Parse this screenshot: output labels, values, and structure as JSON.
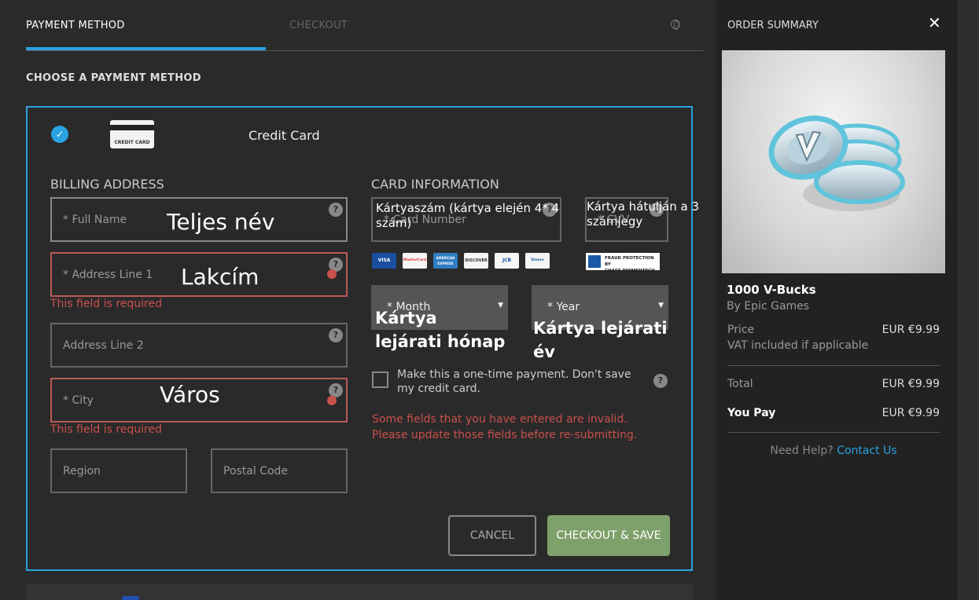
{
  "tabs": {
    "payment_method": "PAYMENT METHOD",
    "checkout": "CHECKOUT"
  },
  "section_heading": "CHOOSE A PAYMENT METHOD",
  "payment_option": {
    "icon_label": "CREDIT CARD",
    "title": "Credit Card"
  },
  "billing": {
    "heading": "BILLING ADDRESS",
    "full_name": {
      "placeholder": "* Full Name",
      "overlay": "Teljes név"
    },
    "address1": {
      "placeholder": "* Address Line 1",
      "overlay": "Lakcím",
      "error": "This field is required"
    },
    "address2": {
      "placeholder": "Address Line 2"
    },
    "city": {
      "placeholder": "* City",
      "overlay": "Város",
      "error": "This field is required"
    },
    "region": {
      "placeholder": "Region"
    },
    "postal": {
      "placeholder": "Postal Code"
    }
  },
  "card": {
    "heading": "CARD INFORMATION",
    "number": {
      "placeholder": "* Card Number",
      "overlay": "Kártyaszám (kártya elején 4* 4 szám)"
    },
    "cvv": {
      "placeholder": "* CVV",
      "overlay": "Kártya hátulján a 3 számjegy"
    },
    "logos": [
      "VISA",
      "MasterCard",
      "AMERICAN EXPRESS",
      "DISCOVER",
      "JCB",
      "Diners"
    ],
    "chase_text": [
      "FRAUD PROTECTION BY",
      "CHASE PAYMENTECH"
    ],
    "month": {
      "placeholder": "* Month",
      "overlay": "Kártya lejárati hónap"
    },
    "year": {
      "placeholder": "* Year",
      "overlay": "Kártya lejárati év"
    },
    "one_time_label": "Make this a one-time payment. Don't save my credit card.",
    "invalid_message": "Some fields that you have entered are invalid. Please update those fields before re-submitting."
  },
  "buttons": {
    "cancel": "CANCEL",
    "checkout_save": "CHECKOUT & SAVE"
  },
  "summary": {
    "title": "ORDER SUMMARY",
    "product_name": "1000 V-Bucks",
    "product_by": "By Epic Games",
    "price_label": "Price",
    "price_value": "EUR €9.99",
    "vat_note": "VAT included if applicable",
    "total_label": "Total",
    "total_value": "EUR €9.99",
    "you_pay_label": "You Pay",
    "you_pay_value": "EUR €9.99",
    "help_text": "Need Help?",
    "help_link": "Contact Us"
  },
  "colors": {
    "accent": "#29a3e0",
    "error": "#c9504b",
    "save_button": "#7ea06a"
  }
}
